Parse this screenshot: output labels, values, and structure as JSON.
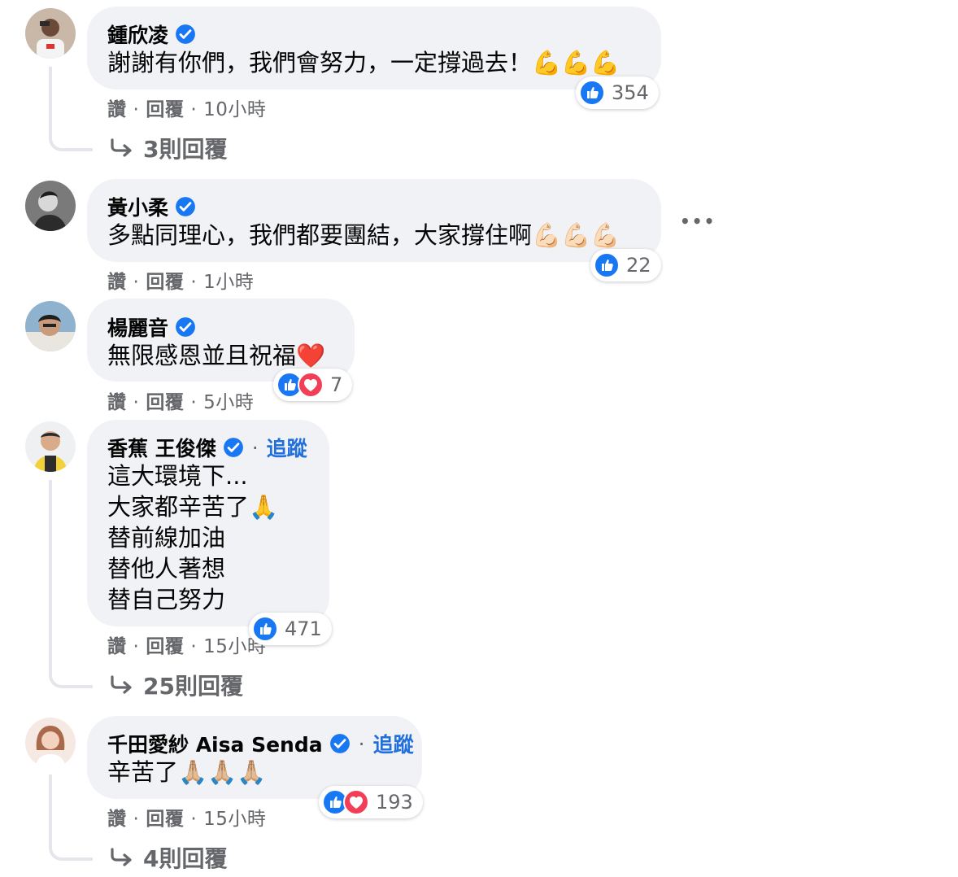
{
  "comments": [
    {
      "author": "鍾欣凌",
      "text": "謝謝有你們，我們會努力，一定撐過去！💪💪💪",
      "like_label": "讚",
      "reply_label": "回覆",
      "time": "10小時",
      "reaction_count": "354",
      "replies_label": "3則回覆"
    },
    {
      "author": "黃小柔",
      "text": "多點同理心，我們都要團結，大家撐住啊💪🏻💪🏻💪🏻",
      "like_label": "讚",
      "reply_label": "回覆",
      "time": "1小時",
      "reaction_count": "22",
      "more": "•••"
    },
    {
      "author": "楊麗音",
      "text": "無限感恩並且祝福❤️",
      "like_label": "讚",
      "reply_label": "回覆",
      "time": "5小時",
      "reaction_count": "7"
    },
    {
      "author": "香蕉 王俊傑",
      "follow": "追蹤",
      "separator": "·",
      "text": "這大環境下...\n大家都辛苦了🙏\n替前線加油\n替他人著想\n替自己努力",
      "like_label": "讚",
      "reply_label": "回覆",
      "time": "15小時",
      "reaction_count": "471",
      "replies_label": "25則回覆"
    },
    {
      "author": "千田愛紗 Aisa Senda",
      "follow": "追蹤",
      "separator": "·",
      "text": "辛苦了🙏🏼🙏🏼🙏🏼",
      "like_label": "讚",
      "reply_label": "回覆",
      "time": "15小時",
      "reaction_count": "193",
      "replies_label": "4則回覆"
    }
  ],
  "colors": {
    "bubble": "#f0f2f5",
    "link": "#216fdb",
    "meta": "#65676b",
    "like_blue": "#1877f2",
    "love_red": "#f33e58"
  },
  "icons": {
    "verified": "verified-badge-icon",
    "like": "like-reaction-icon",
    "love": "love-reaction-icon",
    "reply_arrow": "reply-arrow-icon",
    "more": "more-options-icon"
  }
}
